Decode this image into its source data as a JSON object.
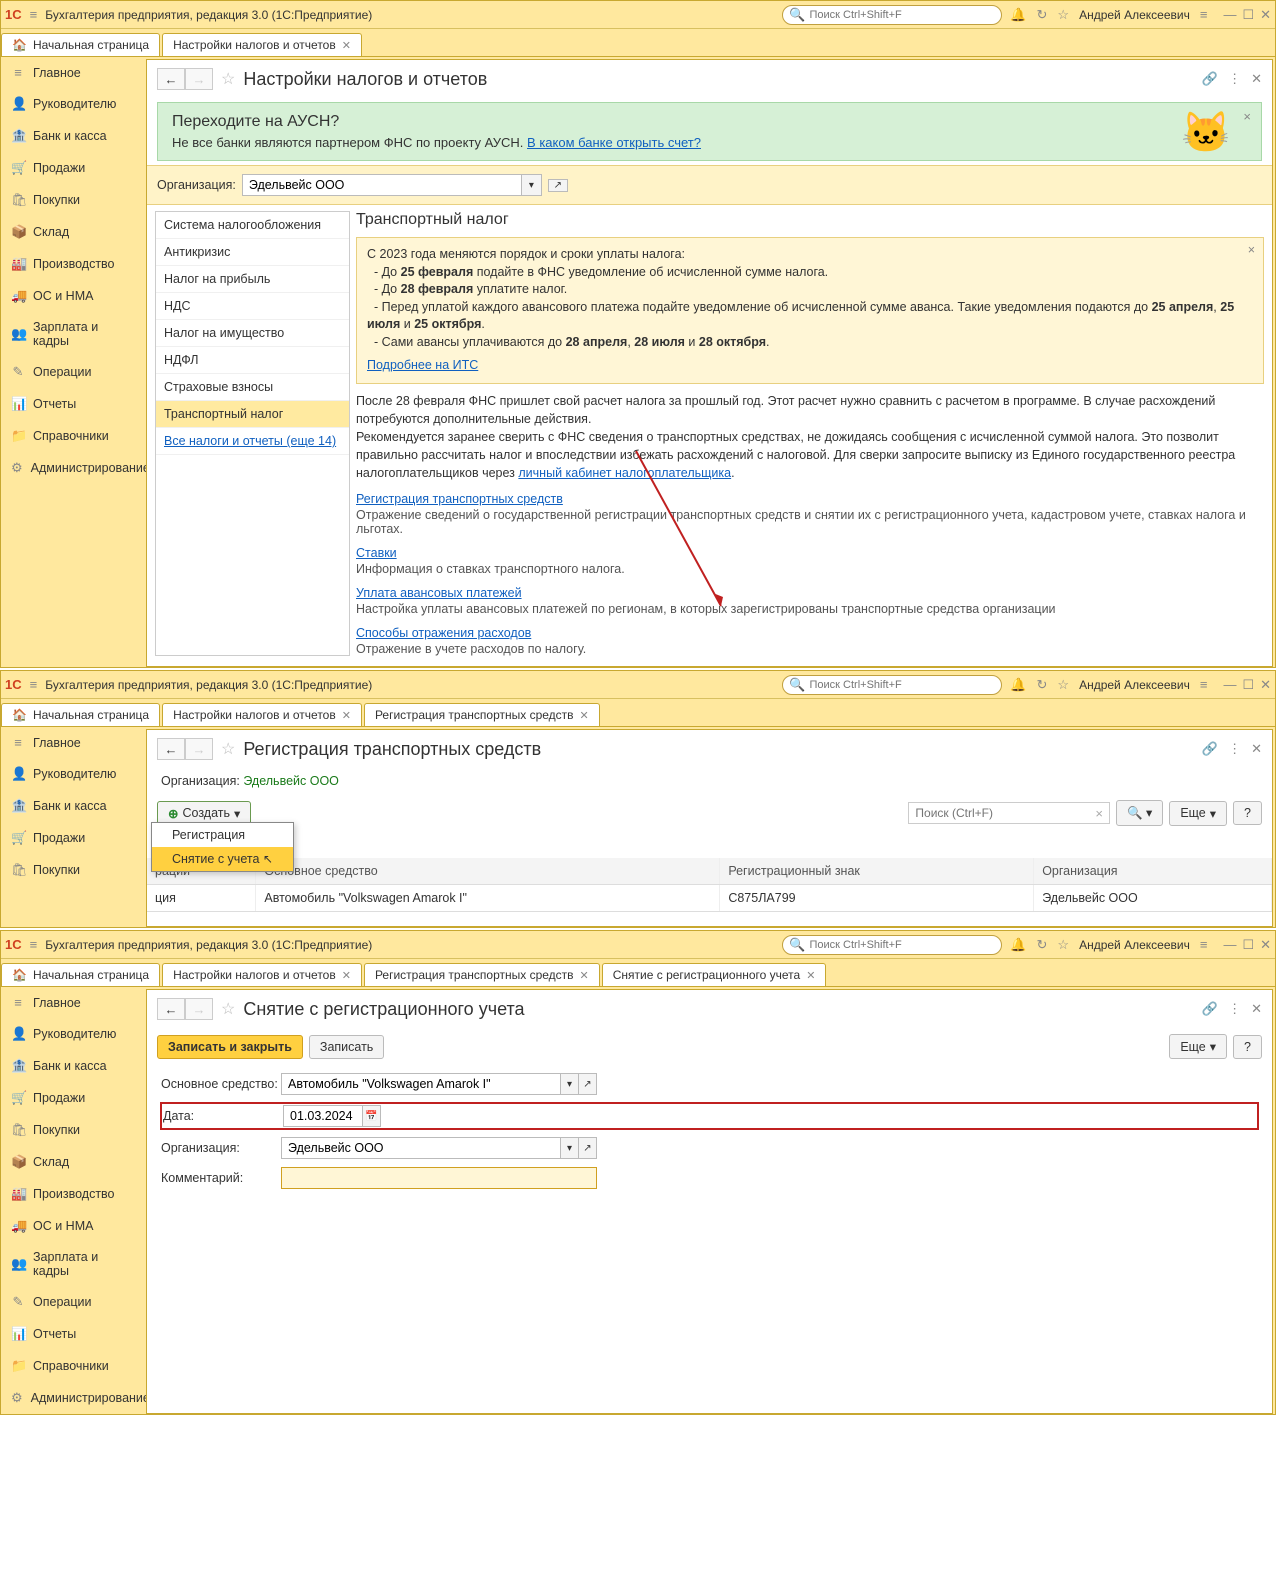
{
  "app": {
    "title": "Бухгалтерия предприятия, редакция 3.0  (1С:Предприятие)",
    "search_placeholder": "Поиск Ctrl+Shift+F",
    "user": "Андрей Алексеевич"
  },
  "sidebar": {
    "items": [
      {
        "label": "Главное",
        "icon": "≡"
      },
      {
        "label": "Руководителю",
        "icon": "👤"
      },
      {
        "label": "Банк и касса",
        "icon": "💰"
      },
      {
        "label": "Продажи",
        "icon": "🛒"
      },
      {
        "label": "Покупки",
        "icon": "🛍"
      },
      {
        "label": "Склад",
        "icon": "📦"
      },
      {
        "label": "Производство",
        "icon": "🏭"
      },
      {
        "label": "ОС и НМА",
        "icon": "🚚"
      },
      {
        "label": "Зарплата и кадры",
        "icon": "👥"
      },
      {
        "label": "Операции",
        "icon": "✎"
      },
      {
        "label": "Отчеты",
        "icon": "📊"
      },
      {
        "label": "Справочники",
        "icon": "📁"
      },
      {
        "label": "Администрирование",
        "icon": "⚙"
      }
    ]
  },
  "win1": {
    "tabs": [
      {
        "label": "Начальная страница",
        "home": true
      },
      {
        "label": "Настройки налогов и отчетов",
        "closable": true
      }
    ],
    "page_title": "Настройки налогов и отчетов",
    "banner": {
      "title": "Переходите на АУСН?",
      "text": "Не все банки являются партнером ФНС по проекту АУСН. ",
      "link": "В каком банке открыть счет?"
    },
    "org_label": "Организация:",
    "org_value": "Эдельвейс ООО",
    "leftlist": [
      "Система налогообложения",
      "Антикризис",
      "Налог на прибыль",
      "НДС",
      "Налог на имущество",
      "НДФЛ",
      "Страховые взносы",
      "Транспортный налог",
      "Все налоги и отчеты (еще 14)"
    ],
    "right": {
      "heading": "Транспортный налог",
      "warn_lines": [
        "С 2023 года меняются порядок и сроки уплаты налога:",
        "  - До 25 февраля подайте в ФНС уведомление об исчисленной сумме налога.",
        "  - До 28 февраля уплатите налог.",
        "  - Перед уплатой каждого авансового платежа подайте уведомление об исчисленной сумме аванса. Такие уведомления подаются до 25 апреля, 25 июля и 25 октября.",
        "  - Сами авансы уплачиваются до 28 апреля, 28 июля и 28 октября."
      ],
      "warn_link": "Подробнее на ИТС",
      "info1": "После 28 февраля ФНС пришлет свой расчет налога за прошлый год. Этот расчет нужно сравнить с расчетом в программе. В случае расхождений потребуются дополнительные действия.",
      "info2_a": "Рекомендуется заранее сверить с ФНС сведения о транспортных средствах, не дожидаясь сообщения с исчисленной суммой налога. Это позволит правильно рассчитать налог и впоследствии избежать расхождений с налоговой. Для сверки запросите выписку из Единого государственного реестра налогоплательщиков через ",
      "info2_link": "личный кабинет налогоплательщика",
      "sections": [
        {
          "link": "Регистрация транспортных средств",
          "desc": "Отражение сведений о государственной регистрации транспортных средств и снятии их с регистрационного учета, кадастровом учете, ставках налога и льготах."
        },
        {
          "link": "Ставки",
          "desc": "Информация о ставках транспортного налога."
        },
        {
          "link": "Уплата авансовых платежей",
          "desc": "Настройка уплаты авансовых платежей по регионам, в которых зарегистрированы транспортные средства организации"
        },
        {
          "link": "Способы отражения расходов",
          "desc": "Отражение в учете расходов по налогу."
        }
      ]
    }
  },
  "win2": {
    "tabs": [
      {
        "label": "Начальная страница",
        "home": true
      },
      {
        "label": "Настройки налогов и отчетов",
        "closable": true
      },
      {
        "label": "Регистрация транспортных средств",
        "closable": true
      }
    ],
    "page_title": "Регистрация транспортных средств",
    "org_label": "Организация:",
    "org_value": "Эдельвейс ООО",
    "create_btn": "Создать",
    "search_placeholder": "Поиск (Ctrl+F)",
    "more_btn": "Еще",
    "menu": {
      "item1": "Регистрация",
      "item2": "Снятие с учета"
    },
    "table": {
      "cols": [
        "рации",
        "Основное средство",
        "Регистрационный знак",
        "Организация"
      ],
      "row": [
        "ция",
        "Автомобиль \"Volkswagen Amarok I\"",
        "С875ЛА799",
        "Эдельвейс ООО"
      ]
    }
  },
  "win3": {
    "tabs": [
      {
        "label": "Начальная страница",
        "home": true
      },
      {
        "label": "Настройки налогов и отчетов",
        "closable": true
      },
      {
        "label": "Регистрация транспортных средств",
        "closable": true
      },
      {
        "label": "Снятие с регистрационного учета",
        "closable": true
      }
    ],
    "page_title": "Снятие с регистрационного учета",
    "save_close": "Записать и закрыть",
    "save": "Записать",
    "more_btn": "Еще",
    "form": {
      "asset_label": "Основное средство:",
      "asset_value": "Автомобиль \"Volkswagen Amarok I\"",
      "date_label": "Дата:",
      "date_value": "01.03.2024",
      "org_label": "Организация:",
      "org_value": "Эдельвейс ООО",
      "comment_label": "Комментарий:"
    }
  }
}
